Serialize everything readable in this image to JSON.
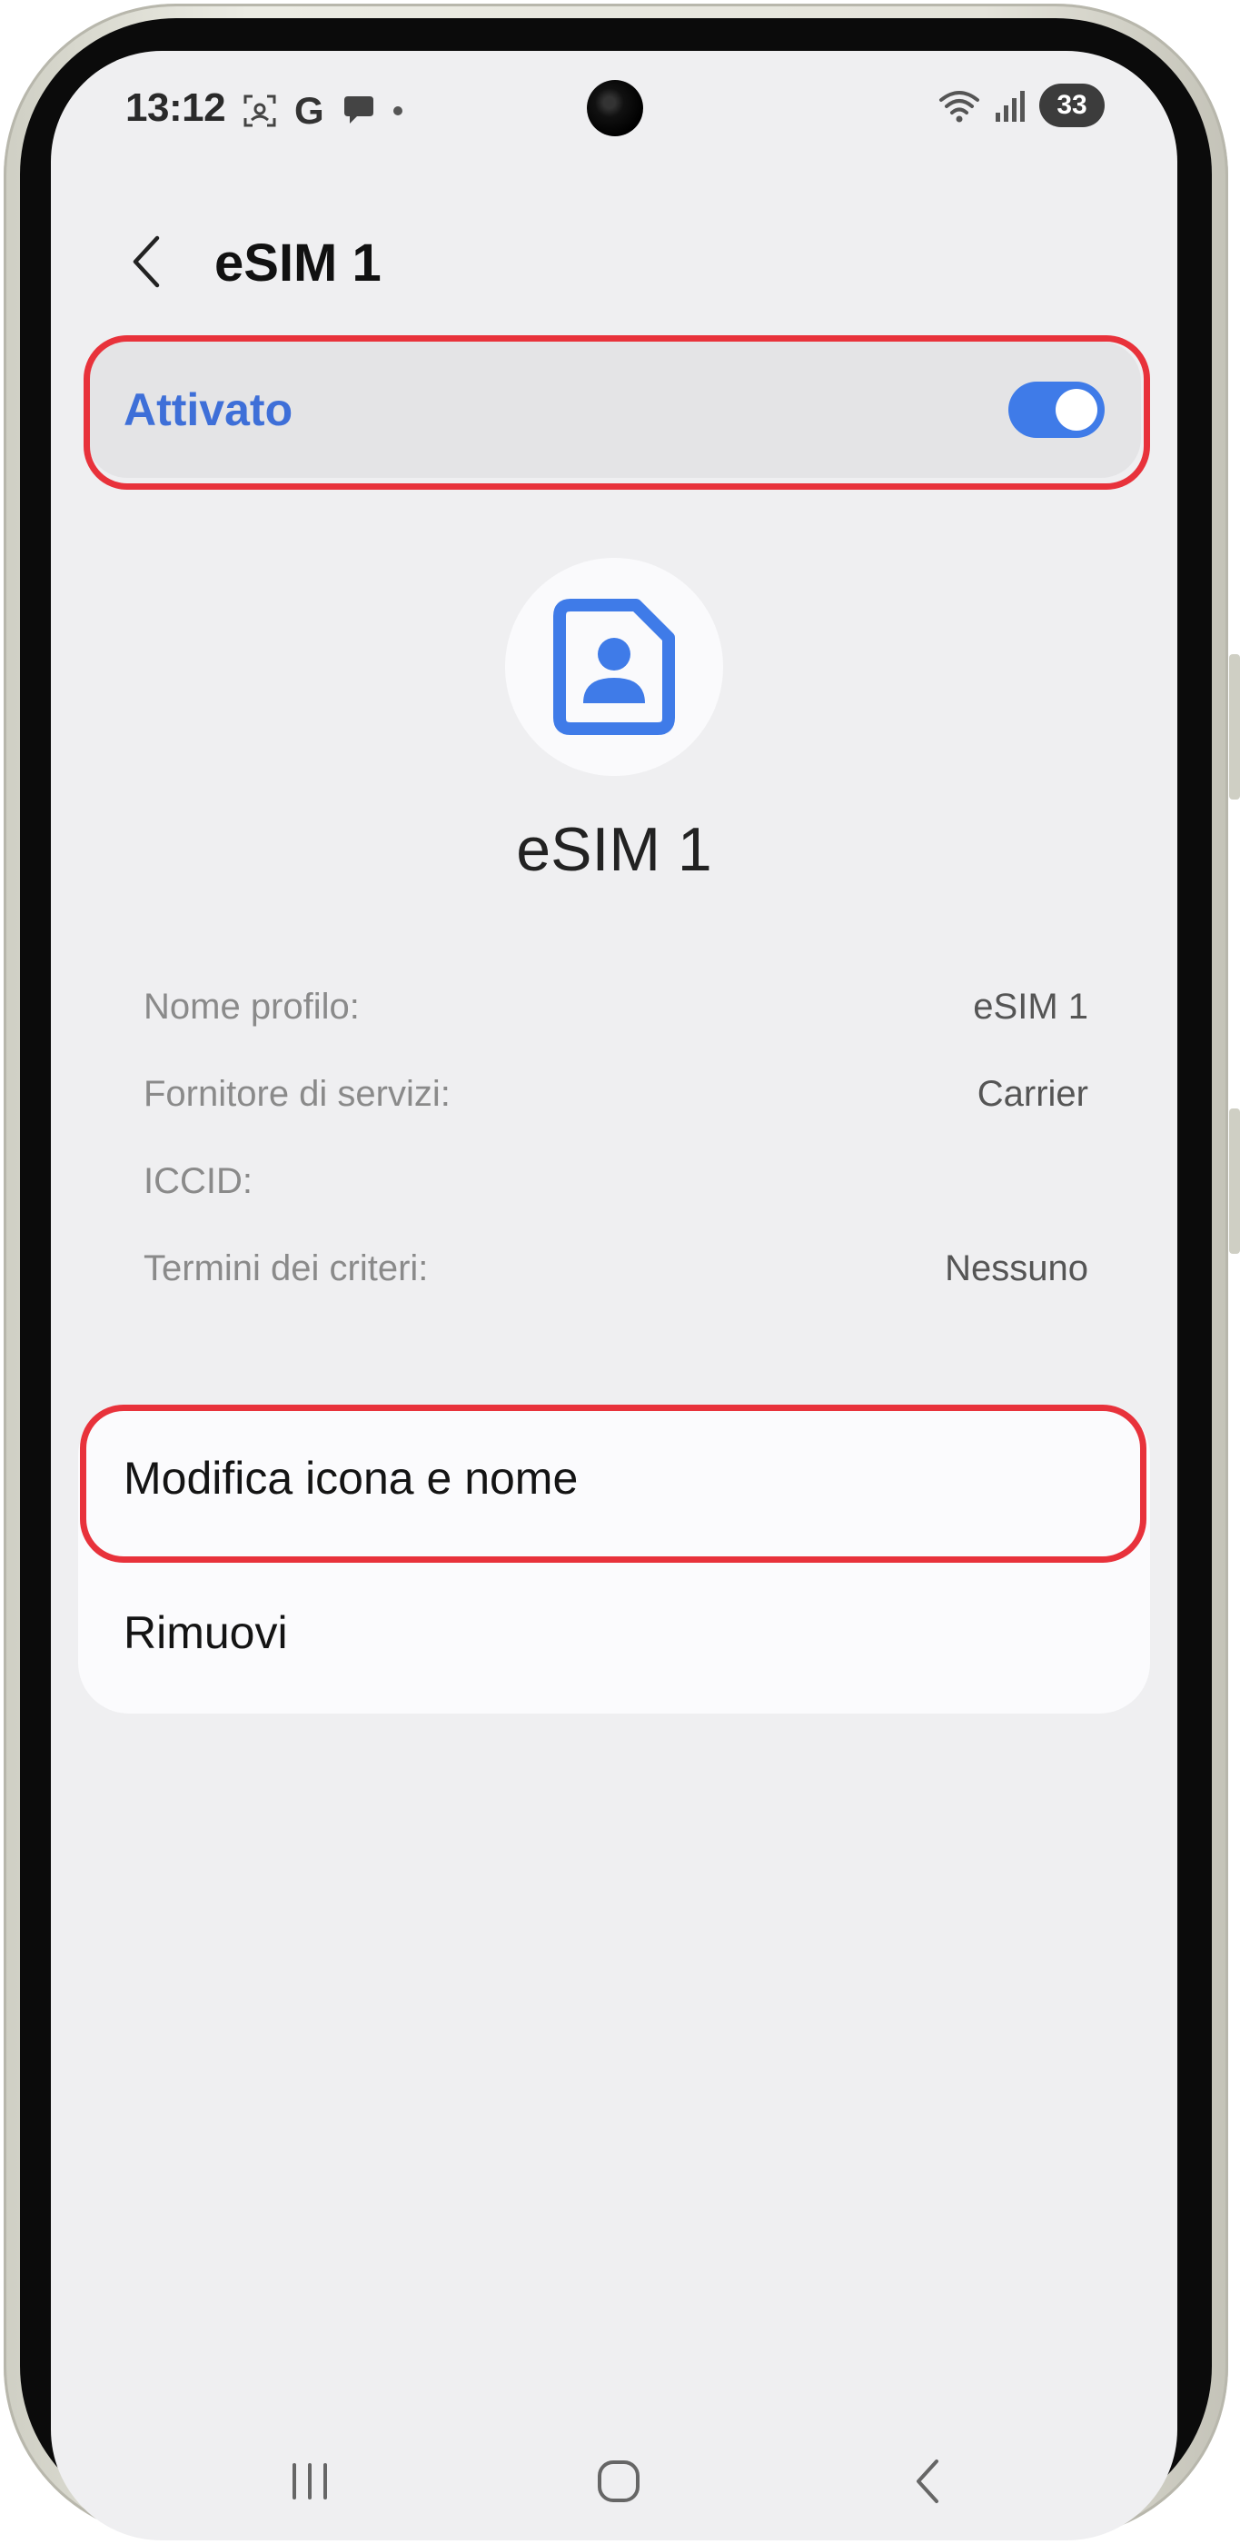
{
  "status_bar": {
    "time": "13:12",
    "notification_icons": [
      "screenshot-icon",
      "google-g-icon",
      "chat-bubble-icon",
      "dot-icon"
    ],
    "google_glyph": "G",
    "battery": "33"
  },
  "app_bar": {
    "title": "eSIM 1"
  },
  "toggle": {
    "label": "Attivato",
    "state": true
  },
  "profile": {
    "name": "eSIM 1"
  },
  "info": [
    {
      "key": "Nome profilo:",
      "value": "eSIM 1"
    },
    {
      "key": "Fornitore di servizi:",
      "value": "Carrier"
    },
    {
      "key": "ICCID:",
      "value": ""
    },
    {
      "key": "Termini dei criteri:",
      "value": "Nessuno"
    }
  ],
  "actions": [
    {
      "label": "Modifica icona e nome"
    },
    {
      "label": "Rimuovi"
    }
  ],
  "colors": {
    "accent": "#3e6fd8",
    "highlight": "#e8323b",
    "background": "#efeff1"
  }
}
